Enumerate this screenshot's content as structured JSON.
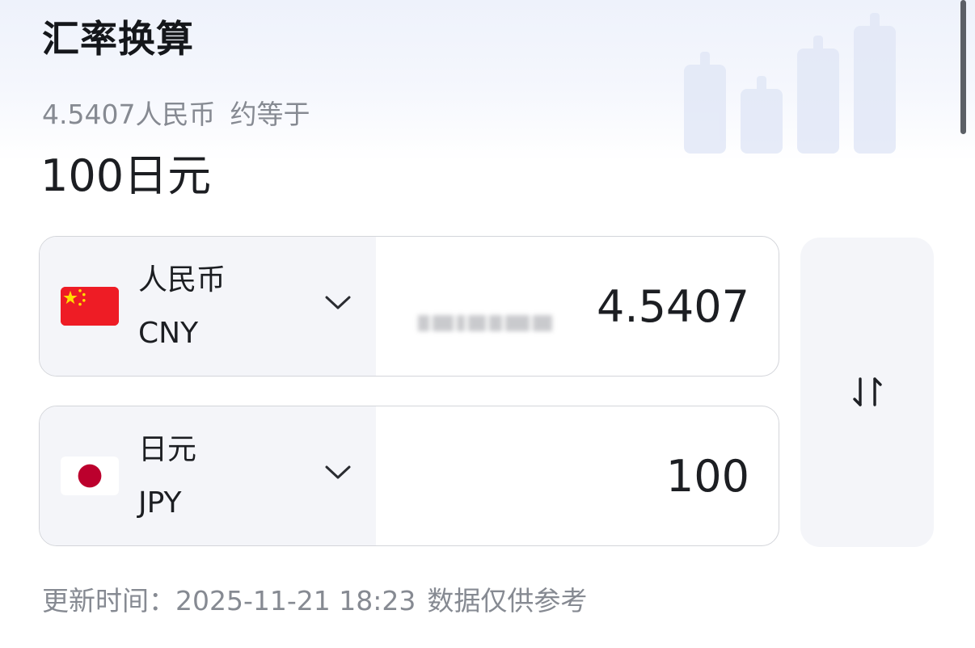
{
  "header": {
    "title": "汇率换算"
  },
  "summary": {
    "from_text": "4.5407人民币",
    "approx_text": "约等于",
    "to_text": "100日元"
  },
  "converter": {
    "from": {
      "name": "人民币",
      "code": "CNY",
      "amount": "4.5407",
      "flag_icon": "china-flag-icon"
    },
    "to": {
      "name": "日元",
      "code": "JPY",
      "amount": "100",
      "flag_icon": "japan-flag-icon"
    },
    "swap_icon": "swap-arrows-icon"
  },
  "footer": {
    "update_label": "更新时间：",
    "update_time": "2025-11-21 18:23",
    "disclaimer": "数据仅供参考"
  },
  "colors": {
    "cny_flag_red": "#ee1c25",
    "cny_flag_star": "#ffde00",
    "jpy_flag_red": "#bc002d",
    "select_bg": "#f4f5f9",
    "muted_text": "#868a92"
  }
}
